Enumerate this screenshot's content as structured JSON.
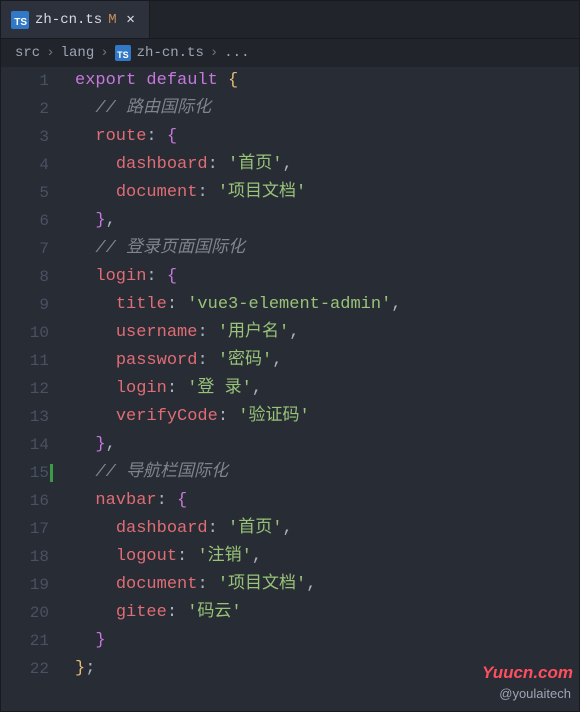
{
  "tab": {
    "icon": "TS",
    "filename": "zh-cn.ts",
    "modified_marker": "M",
    "close_glyph": "✕"
  },
  "breadcrumb": {
    "seg1": "src",
    "seg2": "lang",
    "icon": "TS",
    "seg3": "zh-cn.ts",
    "ellipsis": "...",
    "sep": "›"
  },
  "gutter": {
    "lines": [
      "1",
      "2",
      "3",
      "4",
      "5",
      "6",
      "7",
      "8",
      "9",
      "10",
      "11",
      "12",
      "13",
      "14",
      "15",
      "16",
      "17",
      "18",
      "19",
      "20",
      "21",
      "22"
    ],
    "active_line": 15
  },
  "code": {
    "l1": {
      "kw1": "export",
      "kw2": "default",
      "brace": "{"
    },
    "l2": {
      "comment": "// 路由国际化"
    },
    "l3": {
      "key": "route",
      "colon": ":",
      "brace": "{"
    },
    "l4": {
      "key": "dashboard",
      "colon": ":",
      "val": "'首页'",
      "comma": ","
    },
    "l5": {
      "key": "document",
      "colon": ":",
      "val": "'项目文档'"
    },
    "l6": {
      "brace": "}",
      "comma": ","
    },
    "l7": {
      "comment": "// 登录页面国际化"
    },
    "l8": {
      "key": "login",
      "colon": ":",
      "brace": "{"
    },
    "l9": {
      "key": "title",
      "colon": ":",
      "val": "'vue3-element-admin'",
      "comma": ","
    },
    "l10": {
      "key": "username",
      "colon": ":",
      "val": "'用户名'",
      "comma": ","
    },
    "l11": {
      "key": "password",
      "colon": ":",
      "val": "'密码'",
      "comma": ","
    },
    "l12": {
      "key": "login",
      "colon": ":",
      "val": "'登 录'",
      "comma": ","
    },
    "l13": {
      "key": "verifyCode",
      "colon": ":",
      "val": "'验证码'"
    },
    "l14": {
      "brace": "}",
      "comma": ","
    },
    "l15": {
      "comment": "// 导航栏国际化"
    },
    "l16": {
      "key": "navbar",
      "colon": ":",
      "brace": "{"
    },
    "l17": {
      "key": "dashboard",
      "colon": ":",
      "val": "'首页'",
      "comma": ","
    },
    "l18": {
      "key": "logout",
      "colon": ":",
      "val": "'注销'",
      "comma": ","
    },
    "l19": {
      "key": "document",
      "colon": ":",
      "val": "'项目文档'",
      "comma": ","
    },
    "l20": {
      "key": "gitee",
      "colon": ":",
      "val": "'码云'"
    },
    "l21": {
      "brace": "}"
    },
    "l22": {
      "brace": "}",
      "semi": ";"
    }
  },
  "watermark": {
    "line1": "Yuucn.com",
    "line2": "@youlaitech"
  }
}
